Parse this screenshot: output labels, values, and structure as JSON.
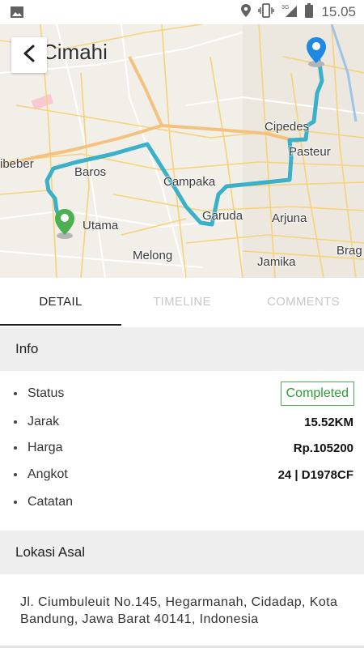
{
  "status_bar": {
    "time": "15.05",
    "network": "3G",
    "icons": [
      "image-icon",
      "location-icon",
      "vibrate-icon",
      "signal-icon",
      "battery-icon"
    ]
  },
  "map": {
    "labels": {
      "cimahi": "Cimahi",
      "cipedes": "Cipedes",
      "pasteur": "Pasteur",
      "cibeber": "ibeber",
      "baros": "Baros",
      "campaka": "Campaka",
      "garuda": "Garuda",
      "arjuna": "Arjuna",
      "utama": "Utama",
      "melong": "Melong",
      "jamika": "Jamika",
      "braga": "Brag"
    },
    "route_color": "#3bb0c9",
    "origin_pin_color": "#4caf50",
    "destination_pin_color": "#1e88e5"
  },
  "tabs": [
    {
      "label": "DETAIL",
      "active": true
    },
    {
      "label": "TIMELINE",
      "active": false
    },
    {
      "label": "COMMENTS",
      "active": false
    }
  ],
  "info": {
    "header": "Info",
    "rows": {
      "status": {
        "label": "Status",
        "value": "Completed"
      },
      "jarak": {
        "label": "Jarak",
        "value": "15.52KM"
      },
      "harga": {
        "label": "Harga",
        "value": "Rp.105200"
      },
      "angkot": {
        "label": "Angkot",
        "value": "24 | D1978CF"
      },
      "catatan": {
        "label": "Catatan",
        "value": ""
      }
    }
  },
  "lokasi_asal": {
    "header": "Lokasi Asal",
    "address": "Jl. Ciumbuleuit No.145, Hegarmanah, Cidadap, Kota Bandung, Jawa Barat 40141, Indonesia"
  },
  "colors": {
    "accent_green": "#4caf50",
    "section_bg": "#eeeeee",
    "tab_active": "#212121",
    "tab_inactive": "#c8c8c8"
  }
}
